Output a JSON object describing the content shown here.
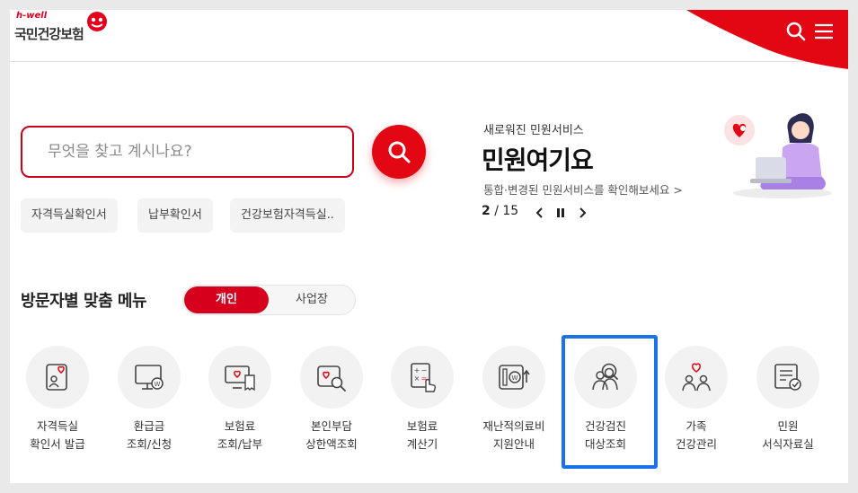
{
  "header": {
    "logo_top": "h-well",
    "logo_bottom": "국민건강보험",
    "search_icon": "search-icon",
    "menu_icon": "hamburger-menu-icon"
  },
  "search": {
    "placeholder": "무엇을 찾고 계시나요?",
    "button_icon": "search-icon",
    "quick_tags": [
      "자격득실확인서",
      "납부확인서",
      "건강보험자격득실.."
    ]
  },
  "promo": {
    "subtitle": "새로워진 민원서비스",
    "title": "민원여기요",
    "description": "통합·변경된 민원서비스를 확인해보세요 >",
    "pager_current": "2",
    "pager_total": "/ 15",
    "prev_icon": "chevron-left-icon",
    "pause_icon": "pause-icon",
    "next_icon": "chevron-right-icon"
  },
  "visitor_menu": {
    "title": "방문자별 맞춤 메뉴",
    "segments": [
      "개인",
      "사업장"
    ],
    "items": [
      {
        "line1": "자격득실",
        "line2": "확인서 발급",
        "icon": "certificate-heart-icon"
      },
      {
        "line1": "환급금",
        "line2": "조회/신청",
        "icon": "monitor-won-icon"
      },
      {
        "line1": "보험료",
        "line2": "조회/납부",
        "icon": "computer-receipt-icon"
      },
      {
        "line1": "본인부담",
        "line2": "상한액조회",
        "icon": "heart-search-icon"
      },
      {
        "line1": "보험료",
        "line2": "계산기",
        "icon": "calculator-hand-icon"
      },
      {
        "line1": "재난적의료비",
        "line2": "지원안내",
        "icon": "won-support-icon"
      },
      {
        "line1": "건강검진",
        "line2": "대상조회",
        "icon": "people-search-icon"
      },
      {
        "line1": "가족",
        "line2": "건강관리",
        "icon": "family-heart-icon"
      },
      {
        "line1": "민원",
        "line2": "서식자료실",
        "icon": "document-check-icon"
      }
    ]
  },
  "colors": {
    "brand_red": "#e30613",
    "highlight_blue": "#1a73e8"
  }
}
